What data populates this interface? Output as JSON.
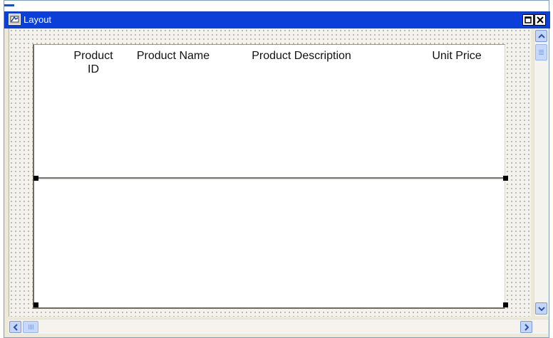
{
  "window": {
    "title": "Layout",
    "title_icon": "layout-window-icon",
    "controls": [
      "restore-icon",
      "close-icon"
    ]
  },
  "report": {
    "columns": [
      {
        "label": "Product\nID"
      },
      {
        "label": "Product Name"
      },
      {
        "label": "Product Description"
      },
      {
        "label": "Unit Price"
      }
    ]
  },
  "colors": {
    "titlebar": "#0b3fd8",
    "title_text": "#ffffff",
    "canvas": "#f3f2ec",
    "grid_dots": "#a8a7a0",
    "scrollbar_button": "#c2d6fb"
  }
}
